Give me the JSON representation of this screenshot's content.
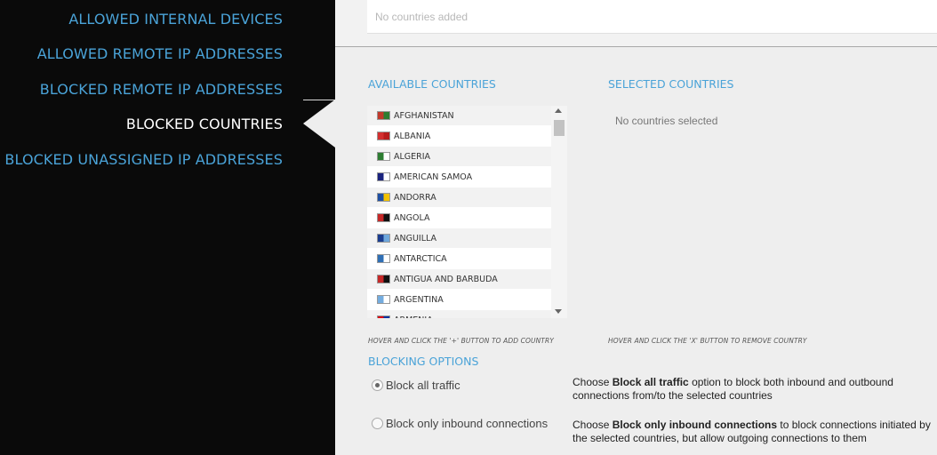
{
  "sidebar": {
    "items": [
      {
        "label": "ALLOWED INTERNAL DEVICES",
        "active": false
      },
      {
        "label": "ALLOWED REMOTE IP ADDRESSES",
        "active": false
      },
      {
        "label": "BLOCKED REMOTE IP ADDRESSES",
        "active": false
      },
      {
        "label": "BLOCKED COUNTRIES",
        "active": true
      },
      {
        "label": "BLOCKED UNASSIGNED IP ADDRESSES",
        "active": false
      }
    ]
  },
  "added": {
    "placeholder": "No countries added"
  },
  "available": {
    "title": "AVAILABLE COUNTRIES",
    "countries": [
      {
        "name": "AFGHANISTAN",
        "flag": [
          "#c0392b",
          "#2e7d32"
        ]
      },
      {
        "name": "ALBANIA",
        "flag": [
          "#d32f2f",
          "#b71c1c"
        ]
      },
      {
        "name": "ALGERIA",
        "flag": [
          "#2e7d32",
          "#ffffff"
        ]
      },
      {
        "name": "AMERICAN SAMOA",
        "flag": [
          "#1a237e",
          "#ffffff"
        ]
      },
      {
        "name": "ANDORRA",
        "flag": [
          "#1e4fa3",
          "#f2c200"
        ]
      },
      {
        "name": "ANGOLA",
        "flag": [
          "#c62828",
          "#111111"
        ]
      },
      {
        "name": "ANGUILLA",
        "flag": [
          "#1a3d8f",
          "#6fa8dc"
        ]
      },
      {
        "name": "ANTARCTICA",
        "flag": [
          "#2f6fb5",
          "#ffffff"
        ]
      },
      {
        "name": "ANTIGUA AND BARBUDA",
        "flag": [
          "#c62828",
          "#111111"
        ]
      },
      {
        "name": "ARGENTINA",
        "flag": [
          "#74acdf",
          "#ffffff"
        ]
      },
      {
        "name": "ARMENIA",
        "flag": [
          "#d90012",
          "#0033a0"
        ]
      }
    ],
    "hint": "HOVER AND CLICK THE '+' BUTTON TO ADD COUNTRY"
  },
  "selected": {
    "title": "SELECTED COUNTRIES",
    "empty": "No countries selected",
    "hint": "HOVER AND CLICK THE 'X' BUTTON TO REMOVE COUNTRY"
  },
  "blocking": {
    "title": "BLOCKING OPTIONS",
    "options": [
      {
        "label": "Block all traffic",
        "checked": true,
        "desc_pre": "Choose ",
        "desc_bold": "Block all traffic",
        "desc_post": " option to block both inbound and outbound connections from/to the selected countries"
      },
      {
        "label": "Block only inbound connections",
        "checked": false,
        "desc_pre": "Choose ",
        "desc_bold": "Block only inbound connections",
        "desc_post": " to block connections initiated by the selected countries, but allow outgoing connections to them"
      }
    ]
  },
  "colors": {
    "accent": "#4aa3d8",
    "sidebar_bg": "#0a0a0a",
    "panel_bg": "#eeeeee"
  }
}
